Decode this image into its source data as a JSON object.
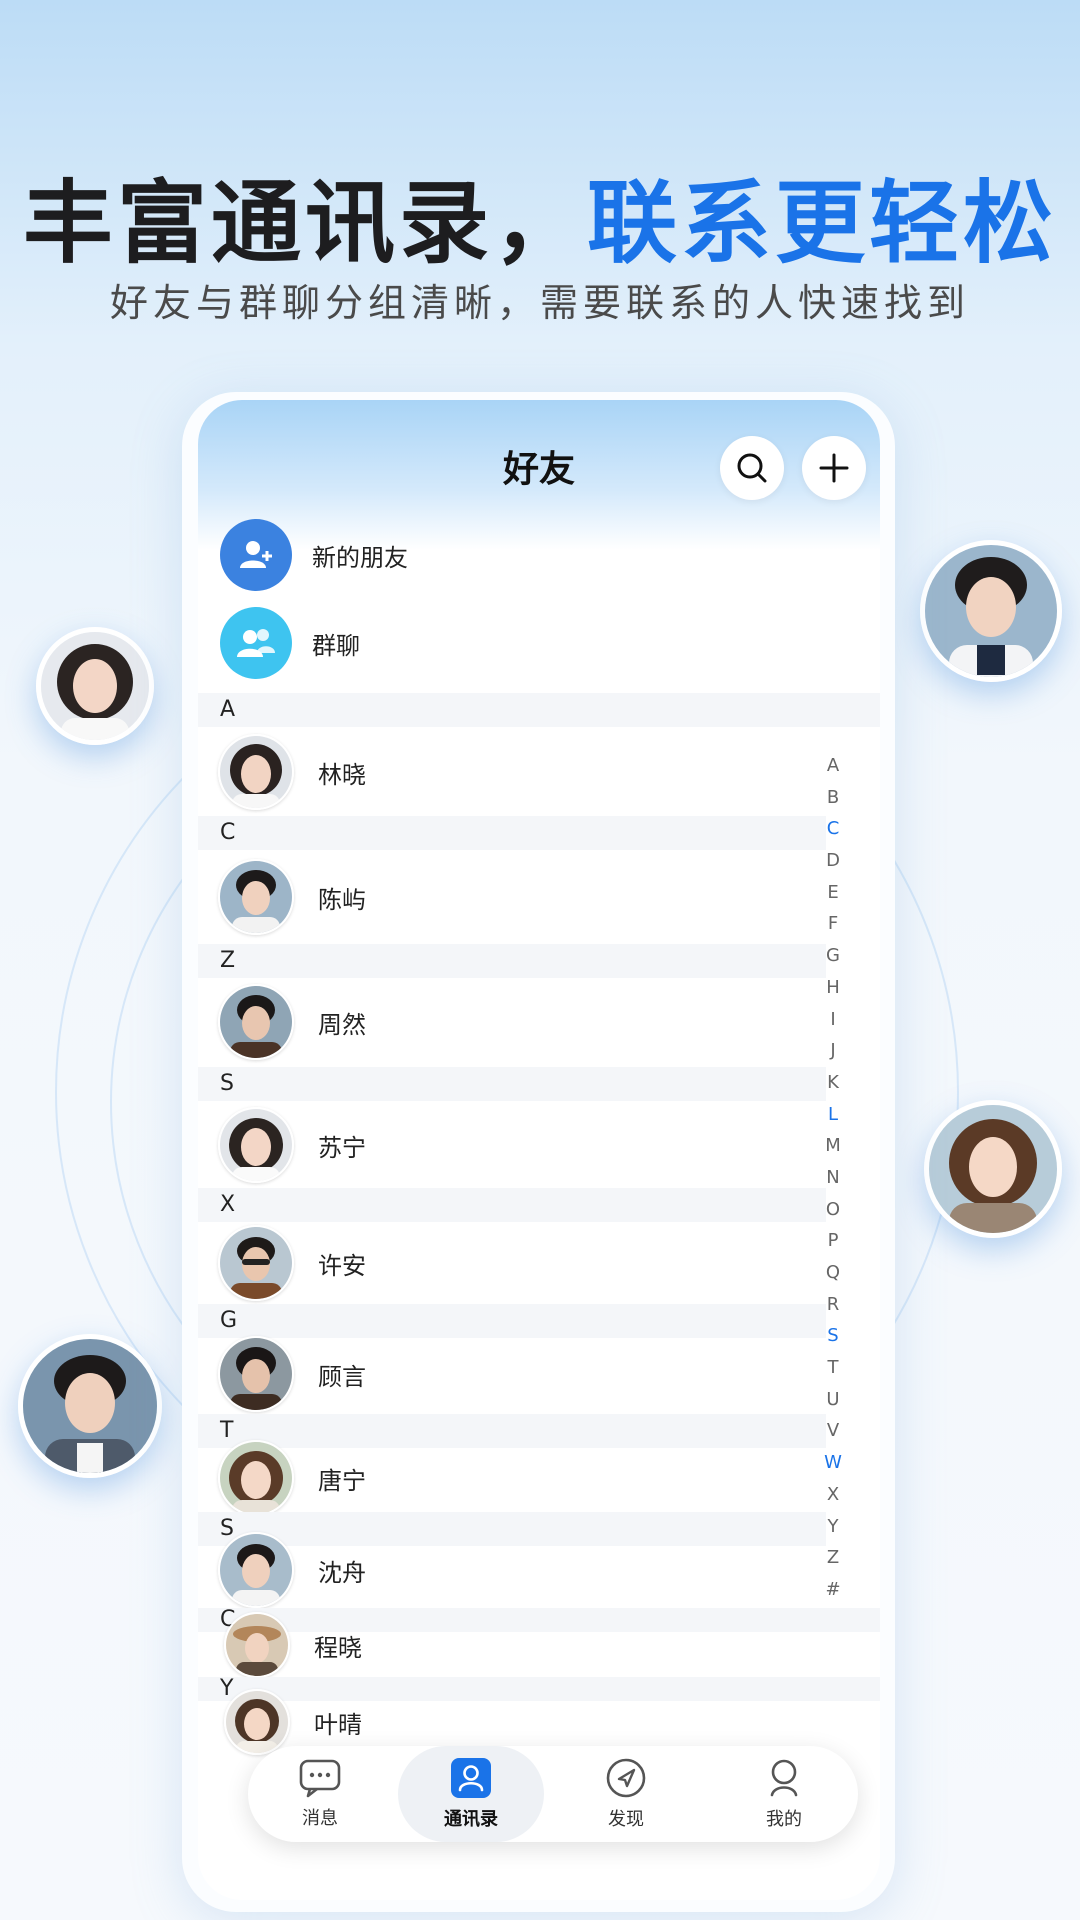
{
  "hero": {
    "title_dark": "丰富通讯录，",
    "title_blue": "联系更轻松",
    "subtitle": "好友与群聊分组清晰，需要联系的人快速找到"
  },
  "colors": {
    "accent": "#1a73e8",
    "new_friend_bg": "#3b82e0",
    "group_bg": "#3ec4f0"
  },
  "screen": {
    "title": "好友",
    "search_icon": "search-icon",
    "add_icon": "plus-icon"
  },
  "special_items": [
    {
      "label": "新的朋友",
      "icon": "add-user-icon"
    },
    {
      "label": "群聊",
      "icon": "group-icon"
    }
  ],
  "contacts": [
    {
      "section": "A",
      "name": "林晓"
    },
    {
      "section": "C",
      "name": "陈屿"
    },
    {
      "section": "Z",
      "name": "周然"
    },
    {
      "section": "S",
      "name": "苏宁"
    },
    {
      "section": "X",
      "name": "许安"
    },
    {
      "section": "G",
      "name": "顾言"
    },
    {
      "section": "T",
      "name": "唐宁"
    },
    {
      "section": "S",
      "name": "沈舟"
    },
    {
      "section": "C",
      "name": "程晓"
    },
    {
      "section": "Y",
      "name": "叶晴"
    }
  ],
  "index_bar": [
    "A",
    "B",
    "C",
    "D",
    "E",
    "F",
    "G",
    "H",
    "I",
    "J",
    "K",
    "L",
    "M",
    "N",
    "O",
    "P",
    "Q",
    "R",
    "S",
    "T",
    "U",
    "V",
    "W",
    "X",
    "Y",
    "Z",
    "#"
  ],
  "index_active": [
    "C",
    "L",
    "S",
    "W"
  ],
  "tabbar": [
    {
      "label": "消息",
      "icon": "chat-icon"
    },
    {
      "label": "通讯录",
      "icon": "contacts-icon",
      "active": true
    },
    {
      "label": "发现",
      "icon": "compass-icon"
    },
    {
      "label": "我的",
      "icon": "profile-icon"
    }
  ]
}
